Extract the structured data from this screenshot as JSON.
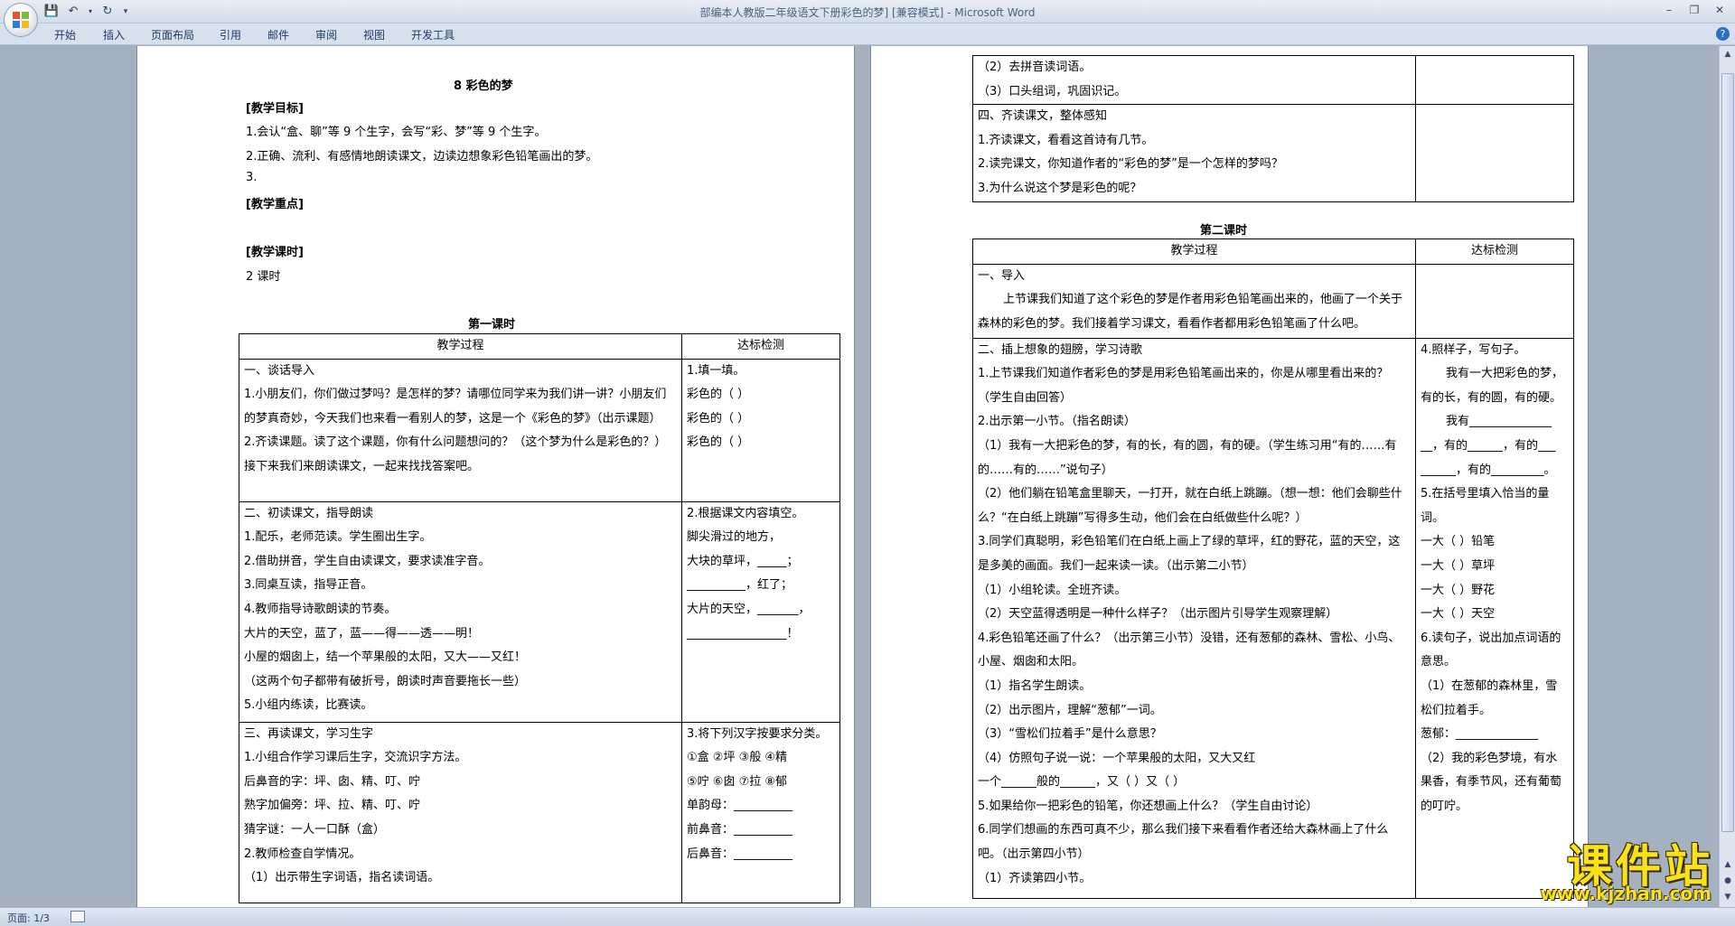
{
  "window": {
    "title": "部编本人教版二年级语文下册彩色的梦] [兼容模式] - Microsoft Word"
  },
  "ribbon": {
    "tabs": [
      "开始",
      "插入",
      "页面布局",
      "引用",
      "邮件",
      "审阅",
      "视图",
      "开发工具"
    ]
  },
  "page1": {
    "heading": "8    彩色的梦",
    "lines": [
      "[教学目标]",
      "1.会认“盒、聊”等 9 个生字，会写“彩、梦”等 9 个生字。",
      "2.正确、流利、有感情地朗读课文，边读边想象彩色铅笔画出的梦。",
      "3.",
      "[教学重点]",
      "",
      "[教学课时]",
      "2 课时",
      ""
    ],
    "lesson_title": "第一课时",
    "table": {
      "headers": [
        "教学过程",
        "达标检测"
      ],
      "rows": [
        {
          "left": [
            "一、谈话导入",
            "1.小朋友们，你们做过梦吗？是怎样的梦？请哪位同学来为我们讲一讲？小朋友们的梦真奇妙，今天我们也来看一看别人的梦，这是一个《彩色的梦》（出示课题）",
            "2.齐读课题。读了这个课题，你有什么问题想问的？（这个梦为什么是彩色的？）接下来我们来朗读课文，一起来找找答案吧。"
          ],
          "right": [
            "1.填一填。",
            "彩色的（          ）",
            "彩色的（          ）",
            "彩色的（          ）"
          ]
        },
        {
          "left": [
            "二、初读课文，指导朗读",
            "1.配乐，老师范读。学生圈出生字。",
            "2.借助拼音，学生自由读课文，要求读准字音。",
            "3.同桌互读，指导正音。",
            "4.教师指导诗歌朗读的节奏。",
            "大片的天空，蓝了，蓝——得——透——明！",
            "小屋的烟囱上，结一个苹果般的太阳，又大——又红！",
            "（这两个句子都带有破折号，朗读时声音要拖长一些）",
            "5.小组内练读，比赛读。"
          ],
          "right": [
            "2.根据课文内容填空。",
            "脚尖滑过的地方，",
            "大块的草坪，_____；",
            "__________，红了；",
            "大片的天空，_______，",
            "_________________！"
          ]
        },
        {
          "left": [
            "三、再读课文，学习生字",
            "1.小组合作学习课后生字，交流识字方法。",
            "后鼻音的字：坪、囱、精、叮、咛",
            "熟字加偏旁：坪、拉、精、叮、咛",
            "猜字谜：一人一口酥（盒）",
            "2.教师检查自学情况。",
            "（1）出示带生字词语，指名读词语。"
          ],
          "right": [
            "3.将下列汉字按要求分类。",
            "①盒  ②坪    ③般    ④精",
            "⑤咛  ⑥囱    ⑦拉    ⑧郁",
            "单韵母：__________",
            "前鼻音：__________",
            "后鼻音：__________"
          ]
        }
      ]
    }
  },
  "page2": {
    "top_table": {
      "rows": [
        {
          "left": [
            "（2）去拼音读词语。",
            "（3）口头组词，巩固识记。"
          ],
          "right": []
        },
        {
          "left": [
            "四、齐读课文，整体感知",
            "1.齐读课文，看看这首诗有几节。",
            "2.读完课文，你知道作者的“彩色的梦”是一个怎样的梦吗？",
            "3.为什么说这个梦是彩色的呢？"
          ],
          "right": []
        }
      ]
    },
    "lesson_title": "第二课时",
    "table": {
      "headers": [
        "教学过程",
        "达标检测"
      ],
      "rows": [
        {
          "left": [
            "一、导入",
            "上节课我们知道了这个彩色的梦是作者用彩色铅笔画出来的，他画了一个关于森林的彩色的梦。我们接着学习课文，看看作者都用彩色铅笔画了什么吧。"
          ],
          "right": []
        },
        {
          "left": [
            "二、插上想象的翅膀，学习诗歌",
            "1.上节课我们知道作者彩色的梦是用彩色铅笔画出来的，你是从哪里看出来的？（学生自由回答）",
            "2.出示第一小节。（指名朗读）",
            "（1）我有一大把彩色的梦，有的长，有的圆，有的硬。（学生练习用“有的……有的……有的……”说句子）",
            "（2）他们躺在铅笔盒里聊天，一打开，就在白纸上跳蹦。（想一想：他们会聊些什么？“在白纸上跳蹦”写得多生动，他们会在白纸做些什么呢？）",
            "3.同学们真聪明，彩色铅笔们在白纸上画上了绿的草坪，红的野花，蓝的天空，这是多美的画面。我们一起来读一读。（出示第二小节）",
            "（1）小组轮读。全班齐读。",
            "（2）天空蓝得透明是一种什么样子？（出示图片引导学生观察理解）",
            "4.彩色铅笔还画了什么？（出示第三小节）没错，还有葱郁的森林、雪松、小鸟、小屋、烟囱和太阳。",
            "（1）指名学生朗读。",
            "（2）出示图片，理解“葱郁”一词。",
            "（3）“雪松们拉着手”是什么意思？",
            "（4）仿照句子说一说：一个苹果般的太阳，又大又红",
            "一个______般的______，又（ ）又（ ）",
            "5.如果给你一把彩色的铅笔，你还想画上什么？（学生自由讨论）",
            "6.同学们想画的东西可真不少，那么我们接下来看看作者还给大森林画上了什么吧。（出示第四小节）",
            "（1）齐读第四小节。"
          ],
          "right": [
            "4.照样子，写句子。",
            "我有一大把彩色的梦，有的长，有的圆，有的硬。",
            "我有______________",
            "__，有的______，有的___",
            "______，有的_________。",
            "5.在括号里填入恰当的量词。",
            "一大（ ）铅笔",
            "一大（ ）草坪",
            "一大（ ）野花",
            "一大（ ）天空",
            "",
            "6.读句子，说出加点词语的意思。",
            "（1）在葱郁的森林里，雪松们拉着手。",
            "葱郁：______________",
            "（2）我的彩色梦境，有水果香，有季节风，还有葡萄的叮咛。"
          ]
        }
      ]
    }
  },
  "status": {
    "page": "页面: 1/3"
  },
  "watermark": {
    "title": "课件站",
    "url": "www.kjzhan.com"
  }
}
